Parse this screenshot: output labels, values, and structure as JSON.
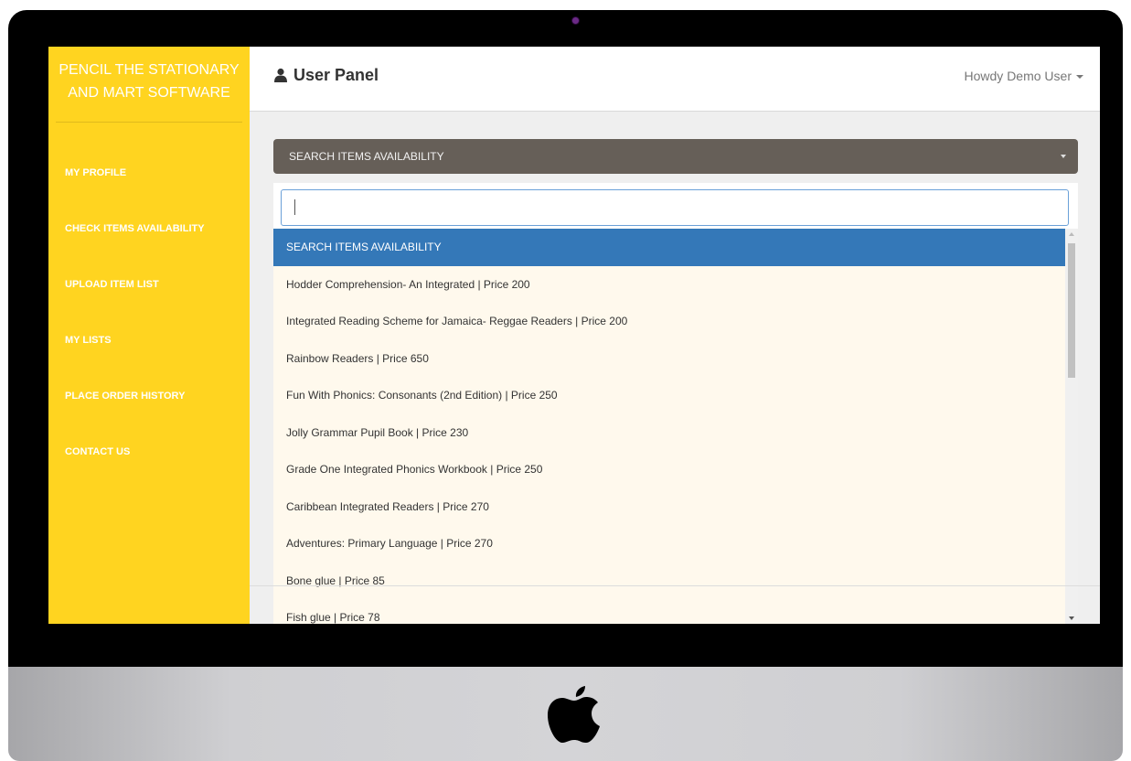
{
  "app": {
    "brand": "PENCIL THE STATIONARY AND MART SOFTWARE"
  },
  "sidebar": {
    "items": [
      {
        "label": "MY PROFILE"
      },
      {
        "label": "CHECK ITEMS AVAILABILITY"
      },
      {
        "label": "UPLOAD ITEM LIST"
      },
      {
        "label": "MY LISTS"
      },
      {
        "label": "PLACE ORDER HISTORY"
      },
      {
        "label": "CONTACT US"
      }
    ]
  },
  "header": {
    "title": "User Panel",
    "user_menu": "Howdy Demo User"
  },
  "select": {
    "value": "SEARCH ITEMS AVAILABILITY",
    "search_value": "",
    "options": [
      {
        "label": "SEARCH ITEMS AVAILABILITY"
      },
      {
        "label": "Hodder Comprehension- An Integrated | Price 200"
      },
      {
        "label": "Integrated Reading Scheme for Jamaica- Reggae Readers | Price 200"
      },
      {
        "label": "Rainbow Readers | Price 650"
      },
      {
        "label": "Fun With Phonics: Consonants (2nd Edition) | Price 250"
      },
      {
        "label": "Jolly Grammar Pupil Book | Price 230"
      },
      {
        "label": "Grade One Integrated Phonics Workbook | Price 250"
      },
      {
        "label": "Caribbean Integrated Readers | Price 270"
      },
      {
        "label": "Adventures: Primary Language | Price 270"
      },
      {
        "label": "Bone glue | Price 85"
      },
      {
        "label": "Fish glue | Price 78"
      }
    ]
  },
  "colors": {
    "sidebar": "#ffd420",
    "select_bar": "#665f58",
    "highlight": "#3478b8",
    "options_bg": "#fff9ed"
  }
}
